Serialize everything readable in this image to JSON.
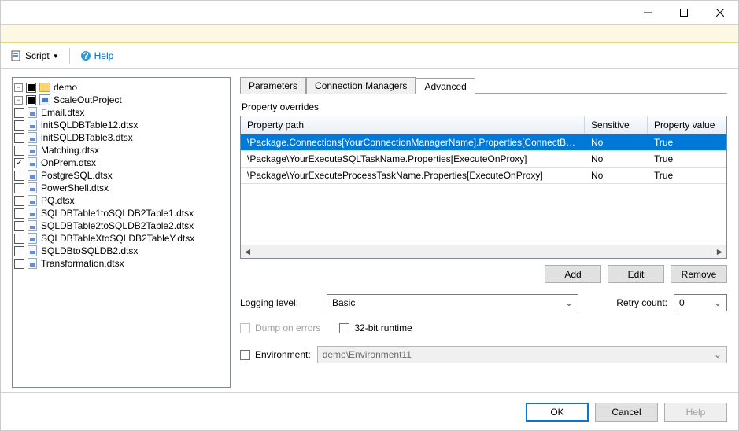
{
  "titlebar": {
    "min": "—",
    "max": "☐",
    "close": "✕"
  },
  "toolbar": {
    "script": "Script",
    "help": "Help"
  },
  "tree": {
    "root": "demo",
    "project": "ScaleOutProject",
    "packages": [
      "Email.dtsx",
      "initSQLDBTable12.dtsx",
      "initSQLDBTable3.dtsx",
      "Matching.dtsx",
      "OnPrem.dtsx",
      "PostgreSQL.dtsx",
      "PowerShell.dtsx",
      "PQ.dtsx",
      "SQLDBTable1toSQLDB2Table1.dtsx",
      "SQLDBTable2toSQLDB2Table2.dtsx",
      "SQLDBTableXtoSQLDB2TableY.dtsx",
      "SQLDBtoSQLDB2.dtsx",
      "Transformation.dtsx"
    ],
    "checked_index": 4
  },
  "tabs": {
    "parameters": "Parameters",
    "cm": "Connection Managers",
    "adv": "Advanced",
    "active": 2
  },
  "overrides": {
    "title": "Property overrides",
    "columns": {
      "path": "Property path",
      "sensitive": "Sensitive",
      "value": "Property value"
    },
    "rows": [
      {
        "path": "\\Package.Connections[YourConnectionManagerName].Properties[ConnectByProxy]",
        "sensitive": "No",
        "value": "True",
        "selected": true
      },
      {
        "path": "\\Package\\YourExecuteSQLTaskName.Properties[ExecuteOnProxy]",
        "sensitive": "No",
        "value": "True",
        "selected": false
      },
      {
        "path": "\\Package\\YourExecuteProcessTaskName.Properties[ExecuteOnProxy]",
        "sensitive": "No",
        "value": "True",
        "selected": false
      }
    ],
    "buttons": {
      "add": "Add",
      "edit": "Edit",
      "remove": "Remove"
    }
  },
  "logging": {
    "label": "Logging level:",
    "value": "Basic",
    "retry_label": "Retry count:",
    "retry_value": "0"
  },
  "checks": {
    "dump": "Dump on errors",
    "runtime": "32-bit runtime"
  },
  "env": {
    "label": "Environment:",
    "value": "demo\\Environment11"
  },
  "footer": {
    "ok": "OK",
    "cancel": "Cancel",
    "help": "Help"
  }
}
